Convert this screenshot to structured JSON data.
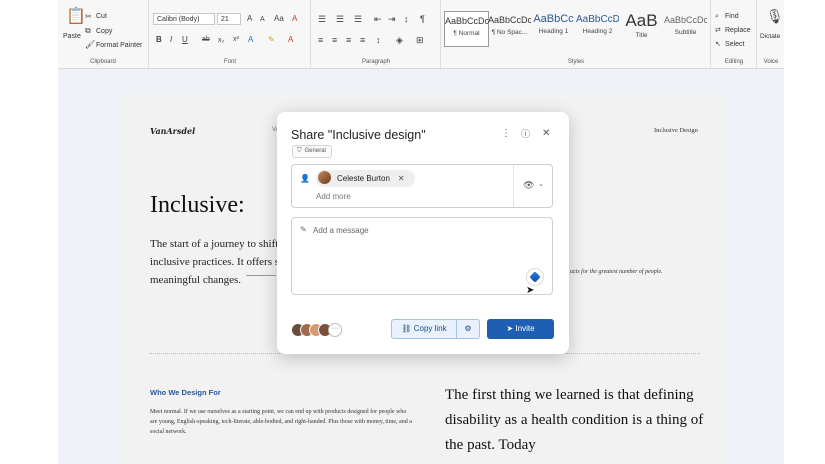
{
  "ribbon": {
    "clipboard": {
      "label": "Clipboard",
      "paste": "Paste",
      "cut": "Cut",
      "copy": "Copy",
      "format_painter": "Format Painter"
    },
    "font": {
      "label": "Font",
      "family": "Calibri (Body)",
      "size": "21"
    },
    "paragraph": {
      "label": "Paragraph"
    },
    "styles": {
      "label": "Styles",
      "items": [
        {
          "sample": "AaBbCcDc",
          "name": "¶ Normal"
        },
        {
          "sample": "AaBbCcDc",
          "name": "¶ No Spac..."
        },
        {
          "sample": "AaBbCc",
          "name": "Heading 1"
        },
        {
          "sample": "AaBbCcD",
          "name": "Heading 2"
        },
        {
          "sample": "AaB",
          "name": "Title"
        },
        {
          "sample": "AaBbCcDc",
          "name": "Subtitle"
        }
      ]
    },
    "editing": {
      "label": "Editing",
      "find": "Find",
      "replace": "Replace",
      "select": "Select"
    },
    "voice": {
      "label": "Voice",
      "dictate": "Dictate"
    }
  },
  "document": {
    "logo": "VanArsdel",
    "logo_cut": "VA",
    "running_head": "Inclusive Design",
    "heading": "Inclusive:",
    "intro": "The start of a journey to shift inclusive practices. It offers s meaningful changes.",
    "quote_fragment": "ucts for the greatest number of people.",
    "section_heading": "Who We Design For",
    "section_body": "Meet normal. If we use ourselves as a starting point, we can end up with products designed for people who are young, English-speaking, tech-literate, able-bodied, and right-handed. Plus those with money, time, and a social network.",
    "big_text": "The first thing we learned is that defining disability as a health condition is a thing of the past. Today"
  },
  "share_dialog": {
    "title": "Share \"Inclusive design\"",
    "sensitivity": "General",
    "recipient": "Celeste Burton",
    "add_more_placeholder": "Add more",
    "message_placeholder": "Add a message",
    "copy_link": "Copy link",
    "invite": "Invite",
    "more_avatars": "···"
  },
  "colors": {
    "accent": "#1f5fb3",
    "link_bg": "#e8f1fc",
    "section_heading": "#2b5797"
  }
}
